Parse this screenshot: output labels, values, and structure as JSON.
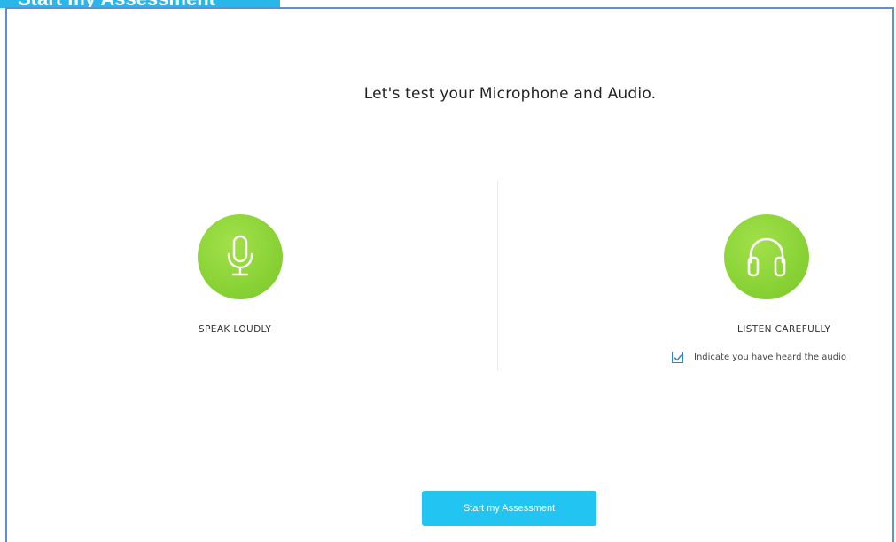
{
  "header": {
    "tab_title": "Start my Assessment"
  },
  "main": {
    "title": "Let's test your Microphone and Audio."
  },
  "speak": {
    "label": "SPEAK LOUDLY",
    "icon": "microphone-icon"
  },
  "listen": {
    "label": "LISTEN CAREFULLY",
    "icon": "headphones-icon",
    "checkbox_label": "Indicate you have heard the audio",
    "checkbox_checked": true
  },
  "actions": {
    "start_label": "Start my Assessment"
  },
  "colors": {
    "accent": "#22c4f2",
    "header": "#29b6e8",
    "frame_border": "#5b8fd6",
    "icon_green": "#8fd63b",
    "checkbox_blue": "#2a86c8"
  }
}
